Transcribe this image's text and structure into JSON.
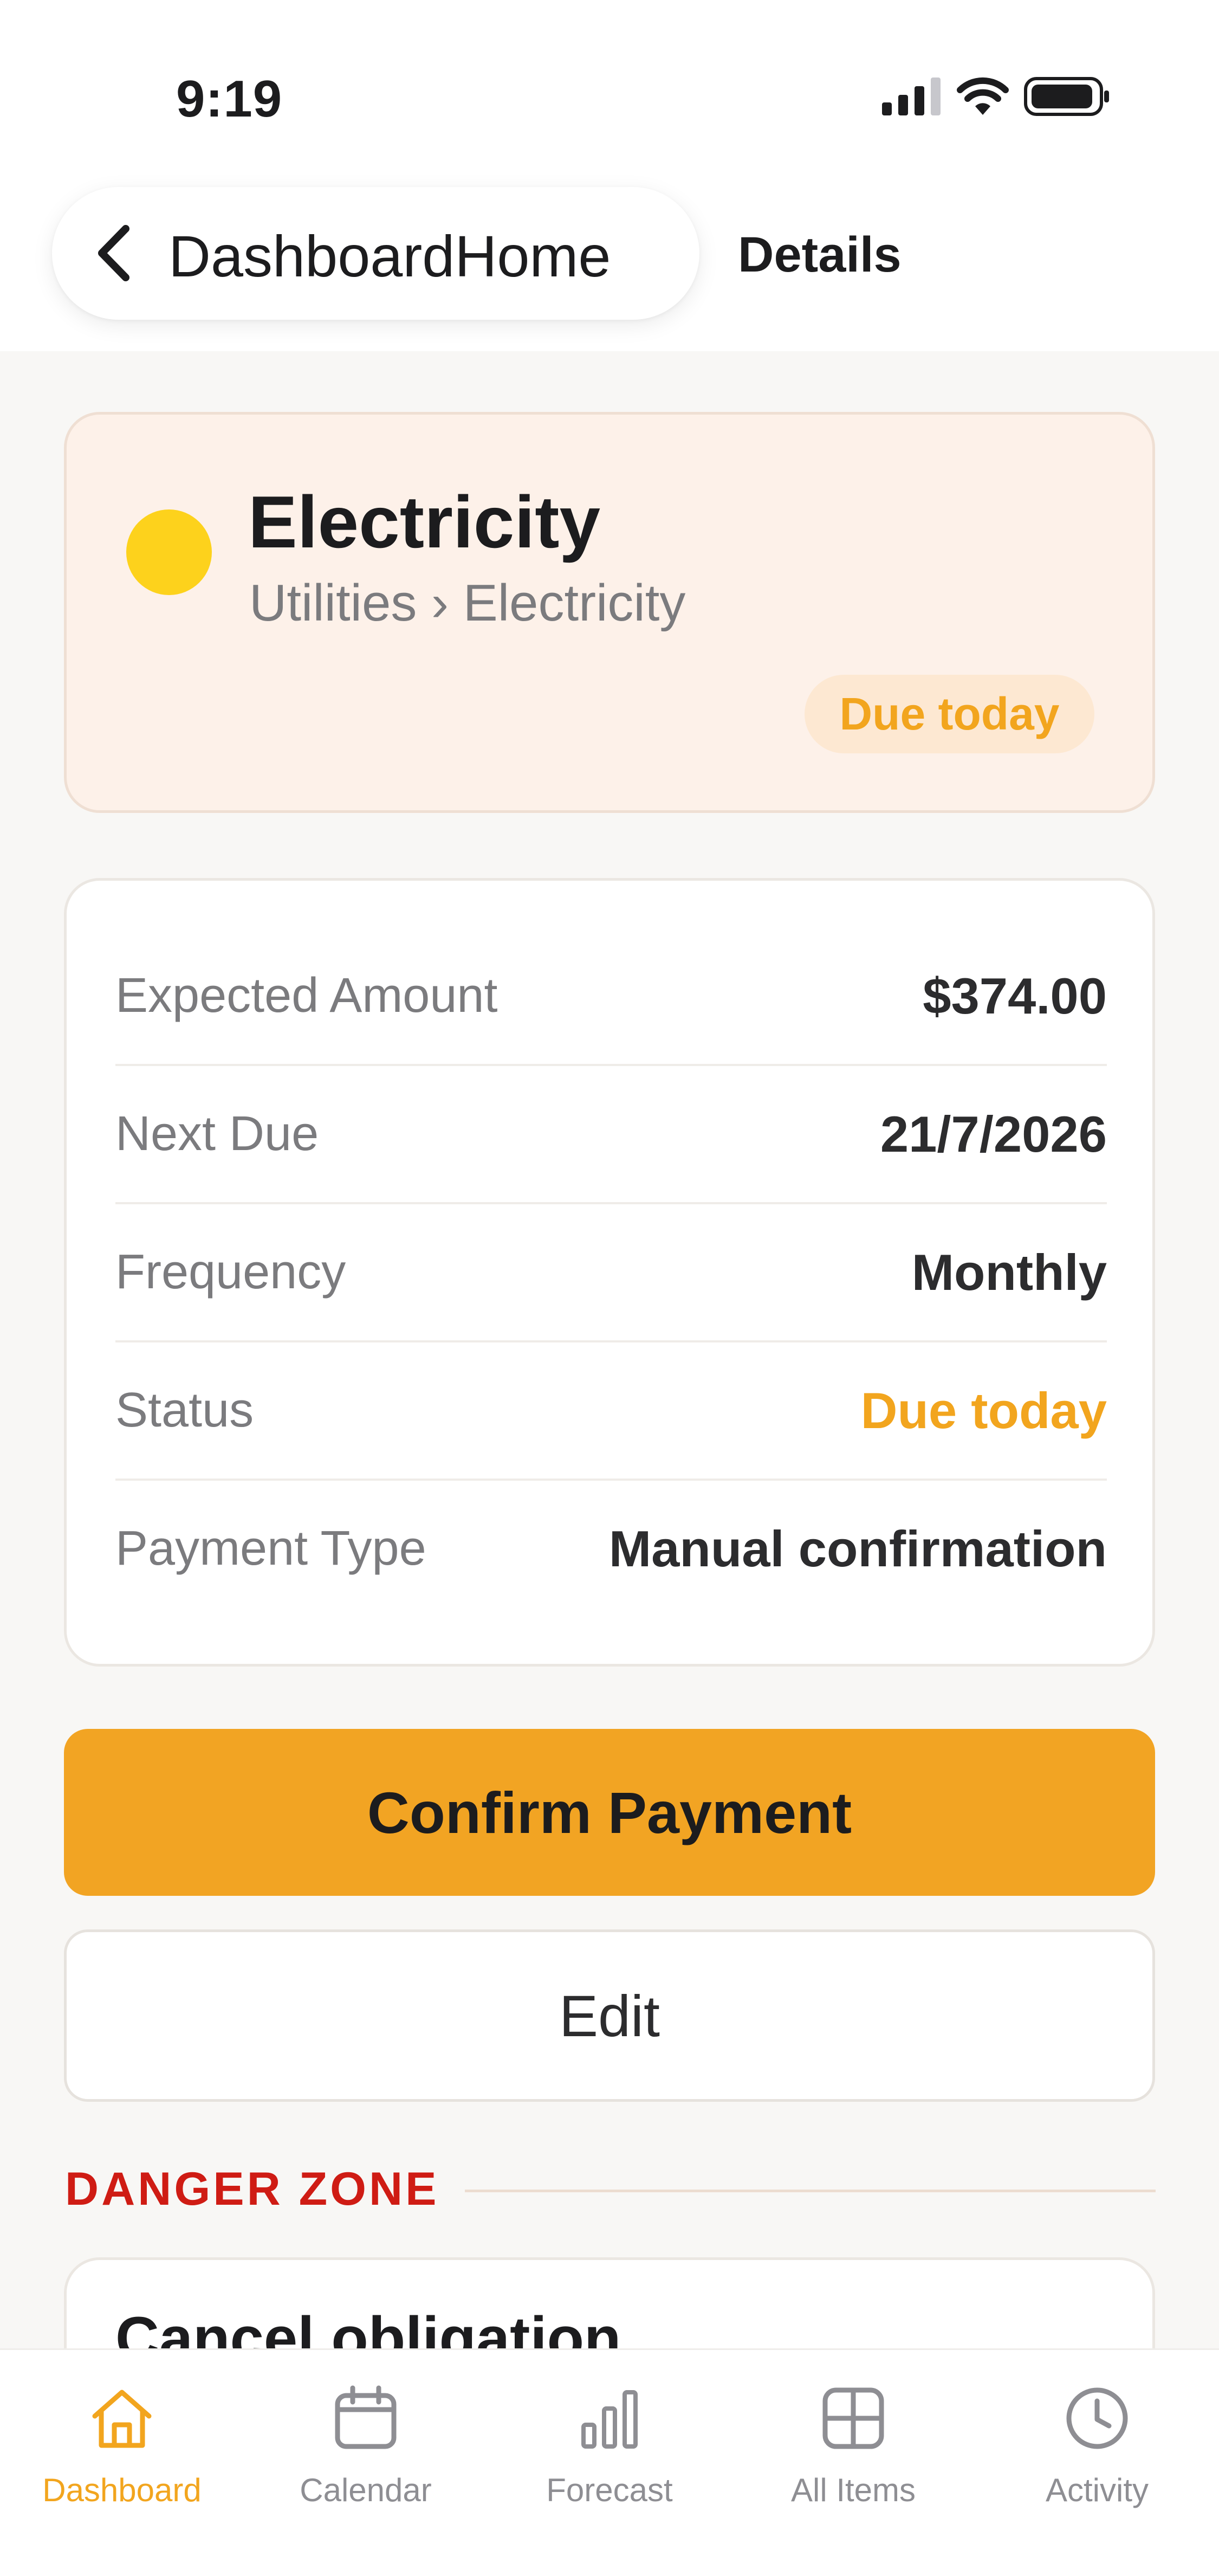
{
  "status_bar": {
    "time": "9:19"
  },
  "nav": {
    "back_label": "DashboardHome",
    "title": "Details"
  },
  "header": {
    "title": "Electricity",
    "breadcrumb": "Utilities › Electricity",
    "badge": "Due today",
    "dot_color": "#FDD21C"
  },
  "details": {
    "rows": [
      {
        "label": "Expected Amount",
        "value": "$374.00"
      },
      {
        "label": "Next Due",
        "value": "21/7/2026"
      },
      {
        "label": "Frequency",
        "value": "Monthly"
      },
      {
        "label": "Status",
        "value": "Due today"
      },
      {
        "label": "Payment Type",
        "value": "Manual confirmation"
      }
    ]
  },
  "actions": {
    "confirm_label": "Confirm Payment",
    "edit_label": "Edit"
  },
  "danger_zone": {
    "title": "DANGER ZONE",
    "card_title": "Cancel obligation"
  },
  "tabbar": {
    "items": [
      {
        "label": "Dashboard",
        "icon": "home-icon",
        "active": true
      },
      {
        "label": "Calendar",
        "icon": "calendar-icon",
        "active": false
      },
      {
        "label": "Forecast",
        "icon": "bar-chart-icon",
        "active": false
      },
      {
        "label": "All Items",
        "icon": "grid-icon",
        "active": false
      },
      {
        "label": "Activity",
        "icon": "clock-icon",
        "active": false
      }
    ]
  },
  "colors": {
    "accent": "#F2A423",
    "danger": "#CF1C14",
    "header_background": "#FDF1E9"
  }
}
